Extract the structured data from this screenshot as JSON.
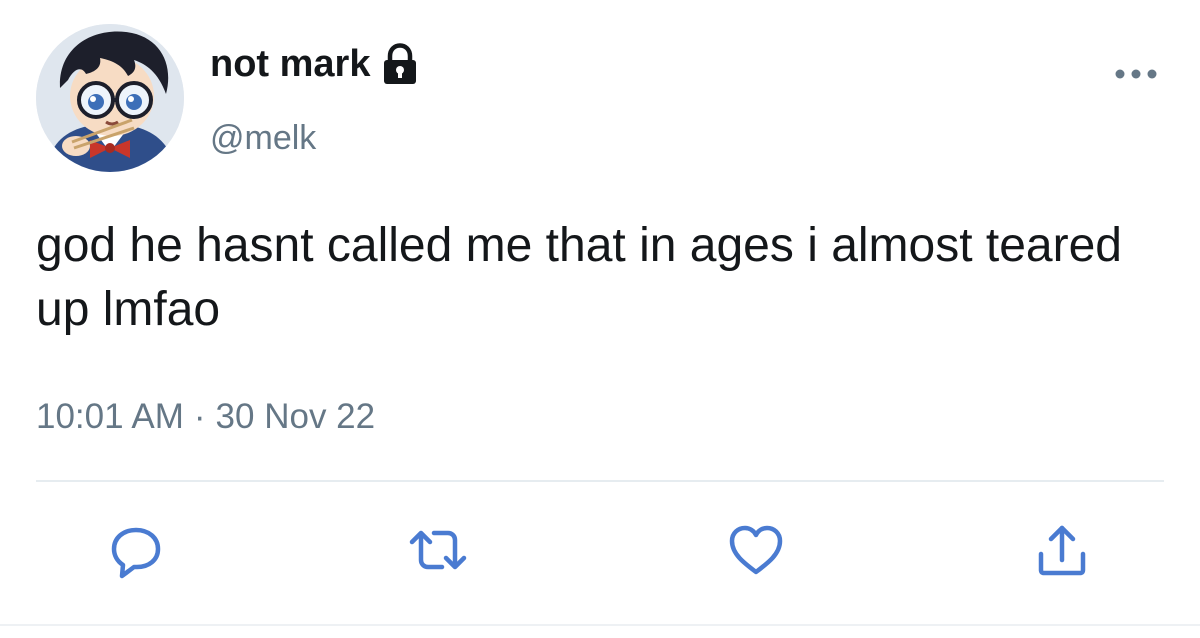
{
  "colors": {
    "text": "#14171a",
    "secondary": "#657786",
    "icon_accent": "#4a7bd1",
    "divider": "#e6ecf0"
  },
  "author": {
    "display_name": "not mark",
    "handle": "@melk",
    "protected_icon": "lock-icon",
    "avatar_icon": "anime-avatar"
  },
  "menu": {
    "icon": "more-icon"
  },
  "tweet": {
    "text": "god he hasnt called me that in ages i almost teared up lmfao",
    "time": "10:01 AM",
    "separator": "·",
    "date": "30 Nov 22"
  },
  "actions": [
    {
      "icon": "reply-icon"
    },
    {
      "icon": "retweet-icon"
    },
    {
      "icon": "like-icon"
    },
    {
      "icon": "share-icon"
    }
  ]
}
